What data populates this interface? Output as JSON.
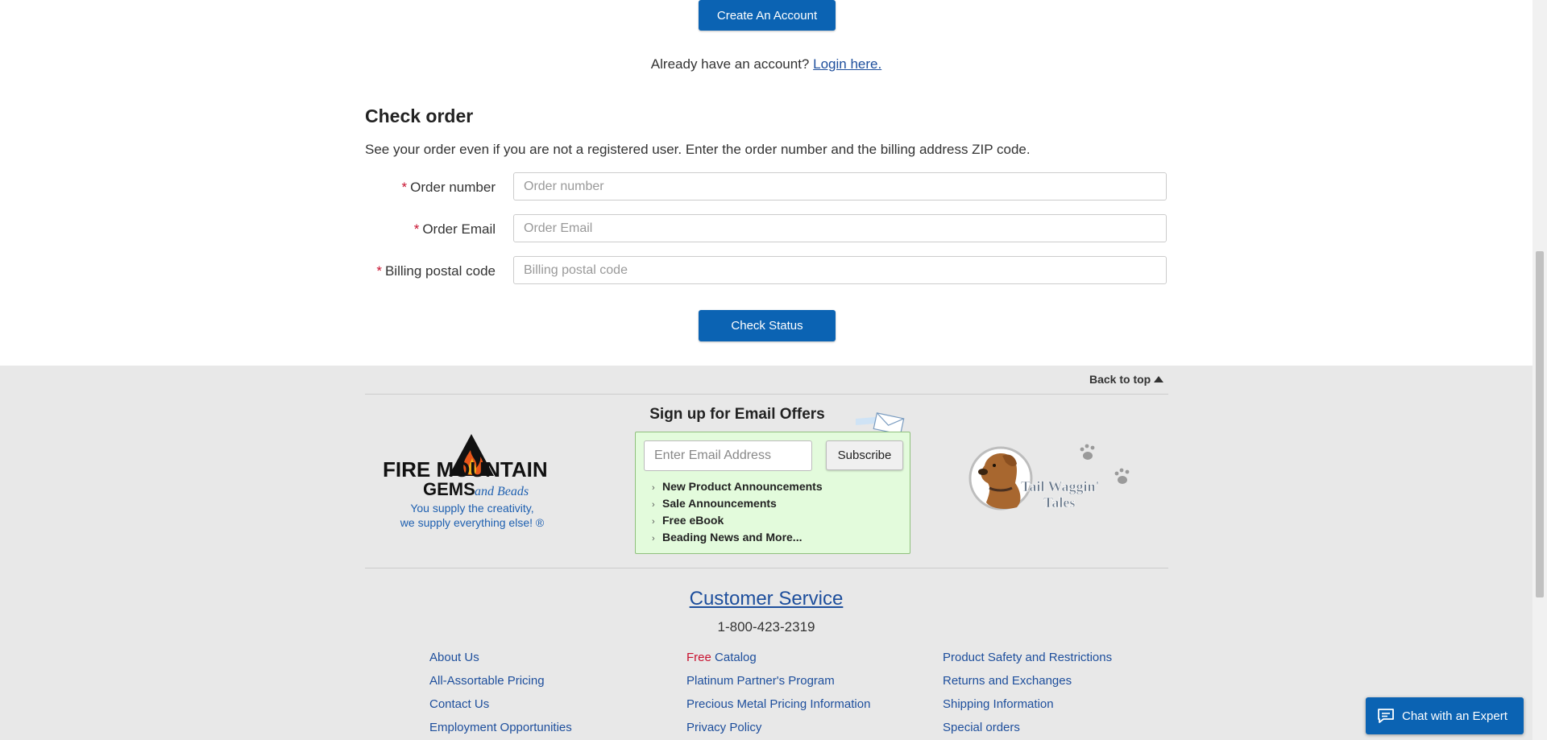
{
  "account": {
    "create_label": "Create An Account",
    "already_text": "Already have an account?",
    "login_link": "Login here."
  },
  "check_order": {
    "title": "Check order",
    "description": "See your order even if you are not a registered user. Enter the order number and the billing address ZIP code.",
    "required_mark": "*",
    "fields": [
      {
        "label": "Order number",
        "placeholder": "Order number",
        "value": ""
      },
      {
        "label": "Order Email",
        "placeholder": "Order Email",
        "value": ""
      },
      {
        "label": "Billing postal code",
        "placeholder": "Billing postal code",
        "value": ""
      }
    ],
    "submit_label": "Check Status"
  },
  "footer": {
    "back_to_top": "Back to top",
    "logo": {
      "line1": "FIRE MOUNTAIN",
      "line2": "GEMS",
      "line3": "and Beads",
      "tagline1": "You supply the creativity,",
      "tagline2": "we supply everything else! ®"
    },
    "signup": {
      "title": "Sign up for Email Offers",
      "email_placeholder": "Enter Email Address",
      "subscribe_label": "Subscribe",
      "benefits": [
        "New Product Announcements",
        "Sale Announcements",
        "Free eBook",
        "Beading News and More..."
      ]
    },
    "tail_waggin": {
      "line1": "Tail Waggin'",
      "line2": "Tales"
    },
    "customer_service": {
      "title": "Customer Service",
      "phone": "1-800-423-2319"
    },
    "links": {
      "col1": [
        "About Us",
        "All-Assortable Pricing",
        "Contact Us",
        "Employment Opportunities"
      ],
      "col2_free_word": "Free",
      "col2_catalog": "Catalog",
      "col2": [
        "Platinum Partner's Program",
        "Precious Metal Pricing Information",
        "Privacy Policy"
      ],
      "col3": [
        "Product Safety and Restrictions",
        "Returns and Exchanges",
        "Shipping Information",
        "Special orders"
      ]
    },
    "chat_label": "Chat with an Expert"
  },
  "colors": {
    "primary_blue": "#0b63b3",
    "link_blue": "#1d4e9c",
    "required_red": "#c8102e",
    "signup_bg": "#e3fbdc",
    "footer_bg": "#e8e8e8"
  }
}
